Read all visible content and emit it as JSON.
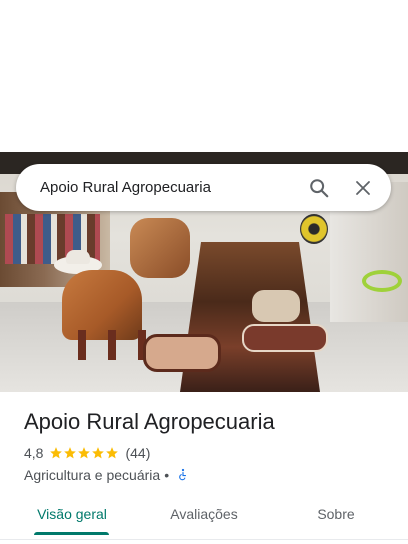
{
  "search": {
    "query": "Apoio Rural Agropecuaria"
  },
  "place": {
    "name": "Apoio Rural Agropecuaria",
    "rating": "4,8",
    "stars_filled": 5,
    "review_count": "(44)",
    "category": "Agricultura e pecuária",
    "separator": "•"
  },
  "tabs": [
    {
      "label": "Visão geral",
      "active": true
    },
    {
      "label": "Avaliações",
      "active": false
    },
    {
      "label": "Sobre",
      "active": false
    }
  ],
  "colors": {
    "accent": "#00796b",
    "star": "#fbbc04",
    "accessibility": "#1a73e8"
  },
  "icons": {
    "search": "search-icon",
    "close": "close-icon",
    "wheelchair": "wheelchair-accessible-icon",
    "star": "star-icon"
  }
}
